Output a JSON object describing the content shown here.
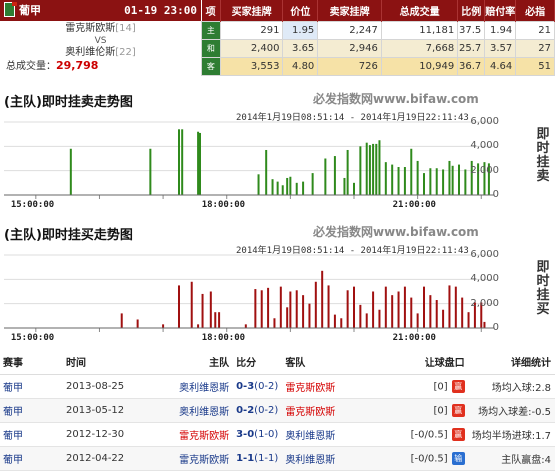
{
  "header": {
    "league": "葡甲",
    "datetime": "01-19 23:00",
    "home": "雷克斯欧斯",
    "home_rank": "[14]",
    "vs": "VS",
    "away": "奥利维伦斯",
    "away_rank": "[22]",
    "total_label": "总成交量：",
    "total_value": "29,798"
  },
  "odds": {
    "headers": [
      "项",
      "买家挂牌",
      "价位",
      "卖家挂牌",
      "总成交量",
      "比例",
      "赔付率",
      "必指"
    ],
    "rows": [
      {
        "label": "主",
        "buy": "291",
        "price": "1.95",
        "sell": "2,247",
        "vol": "11,181",
        "ratio": "37.5",
        "pay": "1.94",
        "idx": "21"
      },
      {
        "label": "和",
        "buy": "2,400",
        "price": "3.65",
        "sell": "2,946",
        "vol": "7,668",
        "ratio": "25.7",
        "pay": "3.57",
        "idx": "27"
      },
      {
        "label": "客",
        "buy": "3,553",
        "price": "4.80",
        "sell": "726",
        "vol": "10,949",
        "ratio": "36.7",
        "pay": "4.64",
        "idx": "51"
      }
    ]
  },
  "charts": [
    {
      "title": "(主队)即时挂卖走势图",
      "watermark": "必发指数网www.bifaw.com",
      "range": "2014年1月19日08:51:14 - 2014年1月19日22:11:43",
      "side_label": "即时挂卖",
      "color": "#2f8a1c"
    },
    {
      "title": "(主队)即时挂买走势图",
      "watermark": "必发指数网www.bifaw.com",
      "range": "2014年1月19日08:51:14 - 2014年1月19日22:11:43",
      "side_label": "即时挂买",
      "color": "#a01010"
    }
  ],
  "chart_data": [
    {
      "type": "bar",
      "title": "(主队)即时挂卖走势图",
      "ylabel": "即时挂卖",
      "ylim": [
        0,
        6000
      ],
      "yticks": [
        "0",
        "2,000",
        "4,000",
        "6,000"
      ],
      "xticks": [
        "15:00:00",
        "18:00:00",
        "21:00:00"
      ],
      "x_range_hours": [
        14.5,
        22.2
      ],
      "x": [
        15.55,
        16.8,
        17.25,
        17.3,
        17.55,
        17.58,
        18.5,
        18.62,
        18.72,
        18.8,
        18.88,
        18.95,
        19.0,
        19.1,
        19.2,
        19.35,
        19.55,
        19.7,
        19.85,
        19.9,
        20.0,
        20.1,
        20.2,
        20.25,
        20.3,
        20.35,
        20.4,
        20.5,
        20.6,
        20.7,
        20.8,
        20.9,
        21.0,
        21.1,
        21.2,
        21.3,
        21.4,
        21.5,
        21.55,
        21.65,
        21.75,
        21.85,
        21.95,
        22.05,
        22.12
      ],
      "values": [
        3800,
        3800,
        5400,
        5400,
        5200,
        5100,
        1700,
        3700,
        1300,
        1100,
        800,
        1400,
        1500,
        1000,
        1100,
        1800,
        3000,
        3200,
        1400,
        3700,
        1000,
        4000,
        4300,
        4100,
        4200,
        4200,
        4500,
        2700,
        2500,
        2300,
        2300,
        3800,
        2800,
        1800,
        2200,
        2200,
        2100,
        2800,
        2400,
        2500,
        2100,
        2800,
        2600,
        2700,
        2600
      ]
    },
    {
      "type": "bar",
      "title": "(主队)即时挂买走势图",
      "ylabel": "即时挂买",
      "ylim": [
        0,
        6000
      ],
      "yticks": [
        "0",
        "2,000",
        "4,000",
        "6,000"
      ],
      "xticks": [
        "15:00:00",
        "18:00:00",
        "21:00:00"
      ],
      "x_range_hours": [
        14.5,
        22.2
      ],
      "x": [
        16.35,
        16.6,
        17.0,
        17.25,
        17.45,
        17.55,
        17.62,
        17.75,
        17.82,
        17.88,
        18.3,
        18.45,
        18.55,
        18.65,
        18.75,
        18.85,
        18.95,
        19.0,
        19.1,
        19.2,
        19.3,
        19.4,
        19.5,
        19.6,
        19.7,
        19.8,
        19.9,
        20.0,
        20.1,
        20.2,
        20.3,
        20.4,
        20.5,
        20.6,
        20.7,
        20.8,
        20.9,
        21.0,
        21.1,
        21.2,
        21.3,
        21.4,
        21.5,
        21.6,
        21.7,
        21.8,
        21.9,
        22.0,
        22.05
      ],
      "values": [
        1200,
        700,
        300,
        3500,
        3800,
        300,
        2800,
        3000,
        1300,
        1300,
        300,
        3200,
        3100,
        3300,
        800,
        3400,
        1700,
        3000,
        3100,
        2700,
        2000,
        3800,
        4700,
        3500,
        1100,
        800,
        3100,
        3400,
        1900,
        1200,
        3000,
        1500,
        3400,
        2700,
        3000,
        3400,
        2500,
        1200,
        3400,
        2700,
        2300,
        1500,
        3500,
        3400,
        2500,
        1300,
        2100,
        2100,
        500
      ]
    }
  ],
  "matches": {
    "headers": [
      "赛事",
      "时间",
      "主队",
      "比分",
      "客队",
      "让球盘口",
      "详细统计"
    ],
    "rows": [
      {
        "league": "葡甲",
        "date": "2013-08-25",
        "home": "奥利维恩斯",
        "home_red": false,
        "score": "0-3",
        "half": "(0-2)",
        "away": "雷克斯欧斯",
        "away_red": true,
        "hcap": "[0]",
        "badge": "赢",
        "badge_color": "#e0301e",
        "stat": "场均入球:2.8"
      },
      {
        "league": "葡甲",
        "date": "2013-05-12",
        "home": "奥利维恩斯",
        "home_red": false,
        "score": "0-2",
        "half": "(0-2)",
        "away": "雷克斯欧斯",
        "away_red": true,
        "hcap": "[0]",
        "badge": "赢",
        "badge_color": "#e0301e",
        "stat": "场均入球差:-0.5"
      },
      {
        "league": "葡甲",
        "date": "2012-12-30",
        "home": "雷克斯欧斯",
        "home_red": true,
        "score": "3-0",
        "half": "(1-0)",
        "away": "奥利维恩斯",
        "away_red": false,
        "hcap": "[-0/0.5]",
        "badge": "赢",
        "badge_color": "#e0301e",
        "stat": "场均半场进球:1.7"
      },
      {
        "league": "葡甲",
        "date": "2012-04-22",
        "home": "雷克斯欧斯",
        "home_red": false,
        "score": "1-1",
        "half": "(1-1)",
        "away": "奥利维恩斯",
        "away_red": false,
        "hcap": "[-0/0.5]",
        "badge": "输",
        "badge_color": "#2a6fd1",
        "stat": "主队赢盘:4"
      }
    ]
  }
}
